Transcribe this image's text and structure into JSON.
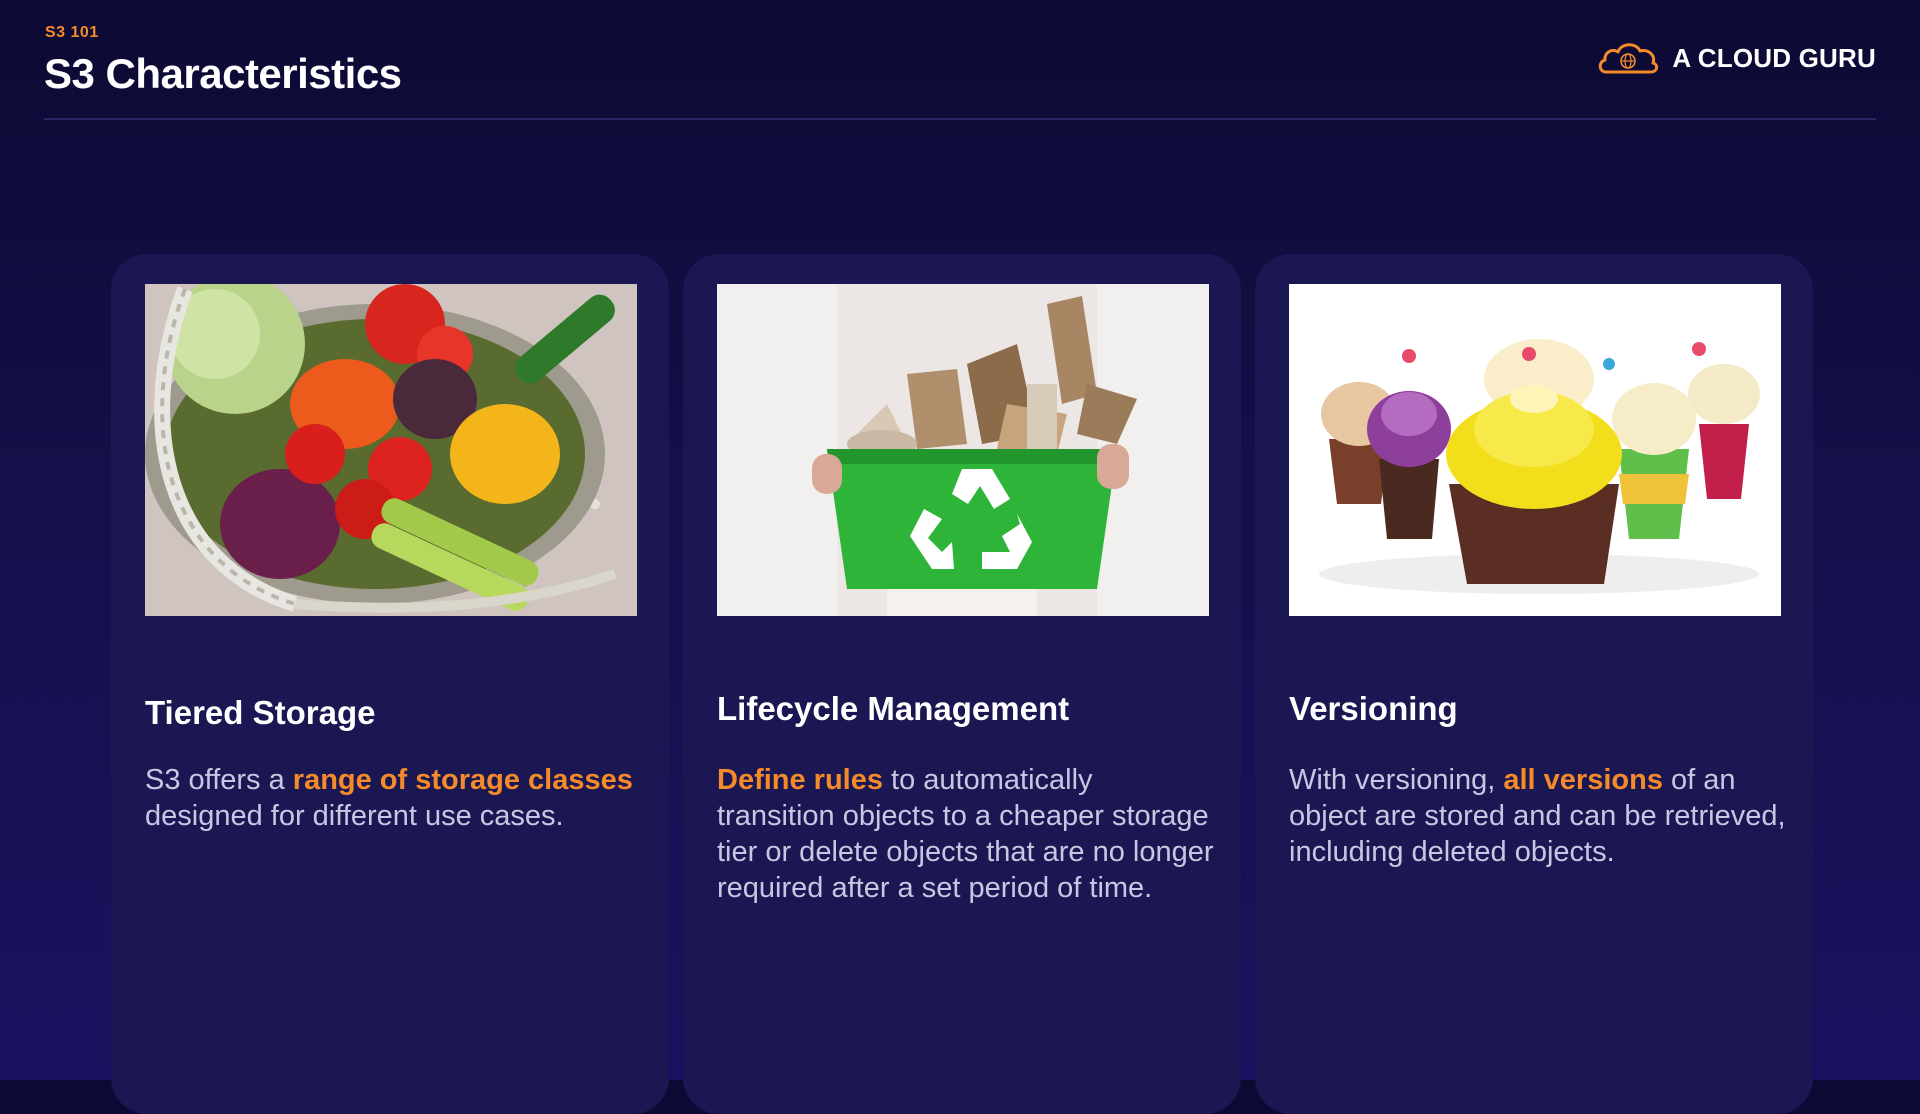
{
  "header": {
    "kicker": "S3 101",
    "title": "S3 Characteristics",
    "brand_name": "A CLOUD GURU",
    "brand_icon": "cloud-logo-icon"
  },
  "colors": {
    "accent": "#f58a2b",
    "background": "#120e45",
    "card": "#1b1752",
    "body_text": "#c9c6e3"
  },
  "cards": [
    {
      "image": "vegetable-basket-image",
      "title": "Tiered Storage",
      "body": [
        {
          "text": "S3 offers a ",
          "highlight": false
        },
        {
          "text": "range of storage classes",
          "highlight": true
        },
        {
          "text": " designed for different use cases.",
          "highlight": false
        }
      ]
    },
    {
      "image": "recycling-bin-image",
      "title": "Lifecycle Management",
      "body": [
        {
          "text": "Define rules",
          "highlight": true
        },
        {
          "text": " to automatically transition objects to a cheaper storage tier or delete objects that are no longer required after a set period of time.",
          "highlight": false
        }
      ]
    },
    {
      "image": "cupcakes-image",
      "title": "Versioning",
      "body": [
        {
          "text": "With versioning, ",
          "highlight": false
        },
        {
          "text": "all versions",
          "highlight": true
        },
        {
          "text": " of an object are stored and can be retrieved, including deleted objects.",
          "highlight": false
        }
      ]
    }
  ]
}
